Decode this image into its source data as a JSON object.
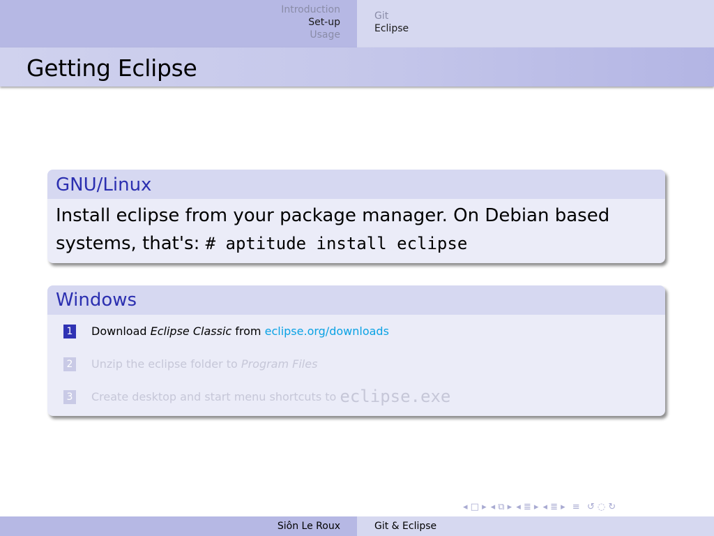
{
  "nav": {
    "left_items": [
      {
        "label": "Introduction",
        "state": "dim"
      },
      {
        "label": "Set-up",
        "state": "active"
      },
      {
        "label": "Usage",
        "state": "dim"
      }
    ],
    "right_items": [
      {
        "label": "Git",
        "state": "dim"
      },
      {
        "label": "Eclipse",
        "state": "active"
      }
    ]
  },
  "frame": {
    "title": "Getting Eclipse"
  },
  "linux_block": {
    "title": "GNU/Linux",
    "text_before": "Install eclipse from your package manager.  On Debian based systems, that's: ",
    "command": "# aptitude install eclipse"
  },
  "windows_block": {
    "title": "Windows",
    "steps": [
      {
        "num": "1",
        "pre": "Download ",
        "em": "Eclipse Classic",
        "mid": " from ",
        "link": "eclipse.org/downloads"
      },
      {
        "num": "2",
        "pre": "Unzip the eclipse folder to ",
        "em": "Program Files"
      },
      {
        "num": "3",
        "pre": "Create desktop and start menu shortcuts to ",
        "code": "eclipse.exe"
      }
    ]
  },
  "footer": {
    "author": "Siôn Le Roux",
    "title": "Git & Eclipse"
  },
  "colors": {
    "accent": "#3033b4",
    "block_title": "#2b2fb0",
    "link": "#0aa2e4",
    "header_dark": "#b6b8e4",
    "header_light": "#d6d8f0"
  },
  "icons": [
    "nav-frame-icon",
    "nav-subsection-icon",
    "nav-section-icon",
    "nav-presentation-icon",
    "nav-search-icon"
  ]
}
